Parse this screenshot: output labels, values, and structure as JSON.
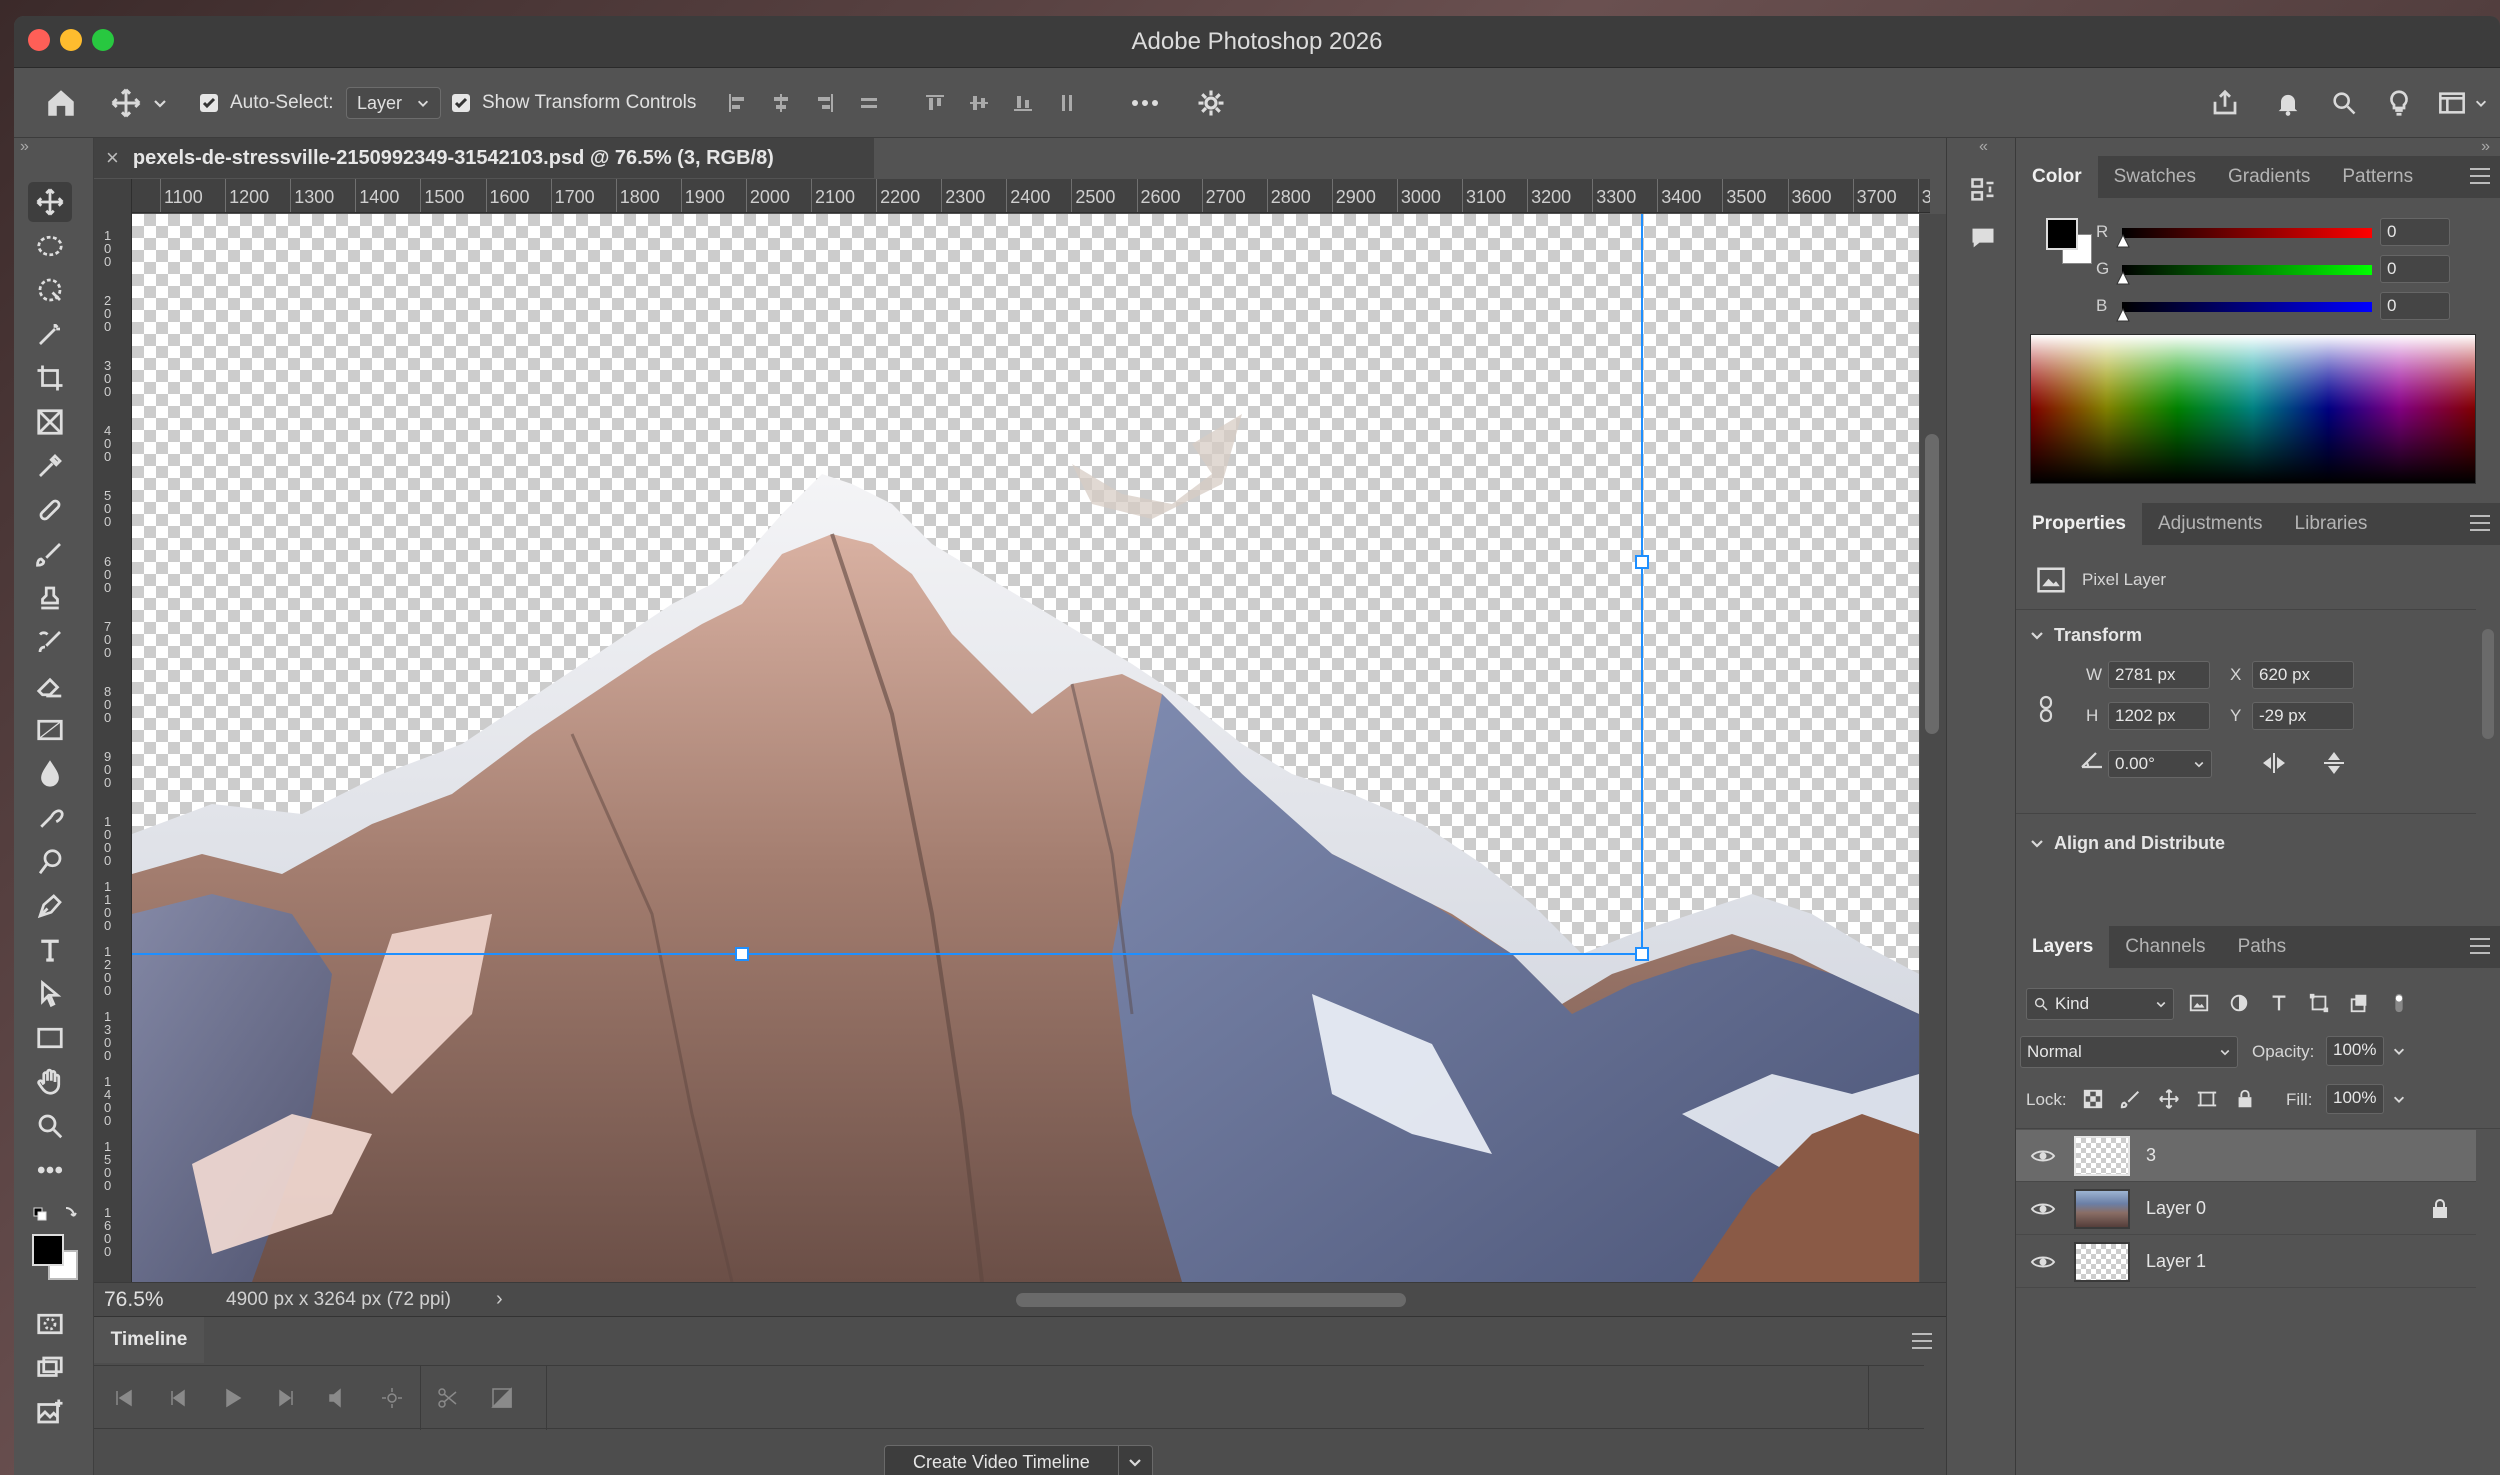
{
  "app": {
    "title": "Adobe Photoshop 2026"
  },
  "options_bar": {
    "auto_select_label": "Auto-Select:",
    "auto_select_value": "Layer",
    "show_transform_label": "Show Transform Controls"
  },
  "document": {
    "tab_title": "pexels-de-stressville-2150992349-31542103.psd @ 76.5% (3, RGB/8)",
    "zoom": "76.5%",
    "size_info": "4900 px x 3264 px (72 ppi)"
  },
  "ruler": {
    "top_labels": [
      "1100",
      "1200",
      "1300",
      "1400",
      "1500",
      "1600",
      "1700",
      "1800",
      "1900",
      "2000",
      "2100",
      "2200",
      "2300",
      "2400",
      "2500",
      "2600",
      "2700",
      "2800",
      "2900",
      "3000",
      "3100",
      "3200",
      "3300",
      "3400",
      "3500",
      "3600",
      "3700",
      "3"
    ],
    "left_labels": [
      "1\n0\n0",
      "2\n0\n0",
      "3\n0\n0",
      "4\n0\n0",
      "5\n0\n0",
      "6\n0\n0",
      "7\n0\n0",
      "8\n0\n0",
      "9\n0\n0",
      "1\n0\n0\n0",
      "1\n1\n0\n0",
      "1\n2\n0\n0",
      "1\n3\n0\n0",
      "1\n4\n0\n0",
      "1\n5\n0\n0",
      "1\n6\n0\n0"
    ]
  },
  "timeline": {
    "tab_label": "Timeline",
    "create_button": "Create Video Timeline"
  },
  "color_panel": {
    "tabs": [
      "Color",
      "Swatches",
      "Gradients",
      "Patterns"
    ],
    "r_label": "R",
    "g_label": "G",
    "b_label": "B",
    "r_value": "0",
    "g_value": "0",
    "b_value": "0"
  },
  "properties_panel": {
    "tabs": [
      "Properties",
      "Adjustments",
      "Libraries"
    ],
    "kind": "Pixel Layer",
    "transform_label": "Transform",
    "w_label": "W",
    "w_value": "2781 px",
    "h_label": "H",
    "h_value": "1202 px",
    "x_label": "X",
    "x_value": "620 px",
    "y_label": "Y",
    "y_value": "-29 px",
    "angle_value": "0.00°",
    "align_label": "Align and Distribute"
  },
  "layers_panel": {
    "tabs": [
      "Layers",
      "Channels",
      "Paths"
    ],
    "filter_label": "Kind",
    "blend_mode": "Normal",
    "opacity_label": "Opacity:",
    "opacity_value": "100%",
    "lock_label": "Lock:",
    "fill_label": "Fill:",
    "fill_value": "100%",
    "layers": [
      {
        "name": "3",
        "selected": true,
        "locked": false
      },
      {
        "name": "Layer 0",
        "selected": false,
        "locked": true
      },
      {
        "name": "Layer 1",
        "selected": false,
        "locked": false
      }
    ]
  },
  "colors": {
    "guide": "#1e8fff",
    "window_bg": "#535353",
    "panel_tab_bg": "#424242"
  }
}
